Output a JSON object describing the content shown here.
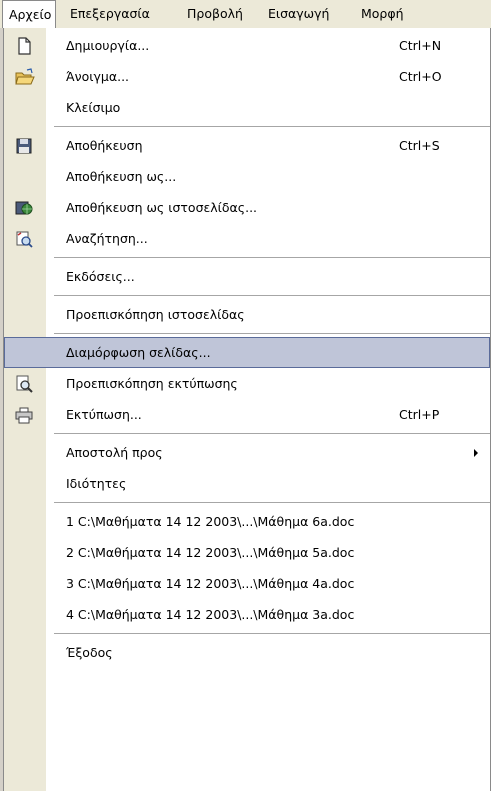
{
  "menubar": {
    "items": [
      "Αρχείο",
      "Επεξεργασία",
      "Προβολή",
      "Εισαγωγή",
      "Μορφή"
    ]
  },
  "file_menu": {
    "new": {
      "label": "Δημιουργία...",
      "shortcut": "Ctrl+N",
      "icon": "new-document-icon"
    },
    "open": {
      "label": "Άνοιγμα...",
      "shortcut": "Ctrl+O",
      "icon": "open-folder-icon"
    },
    "close": {
      "label": "Κλείσιμο"
    },
    "save": {
      "label": "Αποθήκευση",
      "shortcut": "Ctrl+S",
      "icon": "save-floppy-icon"
    },
    "save_as": {
      "label": "Αποθήκευση ως..."
    },
    "save_as_web": {
      "label": "Αποθήκευση ως ιστοσελίδας...",
      "icon": "save-web-page-icon"
    },
    "search": {
      "label": "Αναζήτηση...",
      "icon": "file-search-icon"
    },
    "versions": {
      "label": "Εκδόσεις..."
    },
    "web_preview": {
      "label": "Προεπισκόπηση ιστοσελίδας"
    },
    "page_setup": {
      "label": "Διαμόρφωση σελίδας..."
    },
    "print_preview": {
      "label": "Προεπισκόπηση εκτύπωσης",
      "icon": "print-preview-icon"
    },
    "print": {
      "label": "Εκτύπωση...",
      "shortcut": "Ctrl+P",
      "icon": "printer-icon"
    },
    "send_to": {
      "label": "Αποστολή προς"
    },
    "properties": {
      "label": "Ιδιότητες"
    },
    "recent": [
      "1 C:\\Μαθήματα 14 12 2003\\...\\Μάθημα 6a.doc",
      "2 C:\\Μαθήματα 14 12 2003\\...\\Μάθημα 5a.doc",
      "3 C:\\Μαθήματα 14 12 2003\\...\\Μάθημα 4a.doc",
      "4 C:\\Μαθήματα 14 12 2003\\...\\Μάθημα 3a.doc"
    ],
    "exit": {
      "label": "Έξοδος"
    }
  },
  "colors": {
    "menubar": "#ece9d8",
    "gutter": "#ece9d8",
    "highlight": "#bfc5d8",
    "highlight_border": "#5a6b9a"
  }
}
